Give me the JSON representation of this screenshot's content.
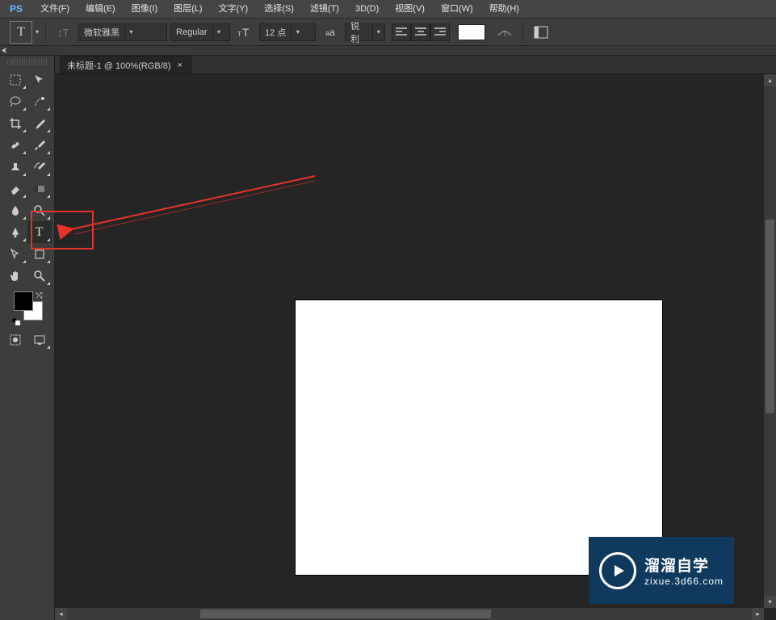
{
  "menu": {
    "logo": "PS",
    "items": [
      "文件(F)",
      "编辑(E)",
      "图像(I)",
      "图层(L)",
      "文字(Y)",
      "选择(S)",
      "滤镜(T)",
      "3D(D)",
      "视图(V)",
      "窗口(W)",
      "帮助(H)"
    ]
  },
  "options": {
    "tool_letter": "T",
    "font_family": "微软雅黑",
    "font_style": "Regular",
    "font_size_value": "12",
    "font_size_unit": "点",
    "aa_label": "a",
    "aa_sup": "a",
    "antialias": "锐利"
  },
  "tab": {
    "label": "未标题-1 @ 100%(RGB/8)"
  },
  "collapse_marker": "⮜",
  "tools_glyphs": {
    "globe": "⊕"
  },
  "watermark": {
    "cn": "溜溜自学",
    "url": "zixue.3d66.com"
  }
}
